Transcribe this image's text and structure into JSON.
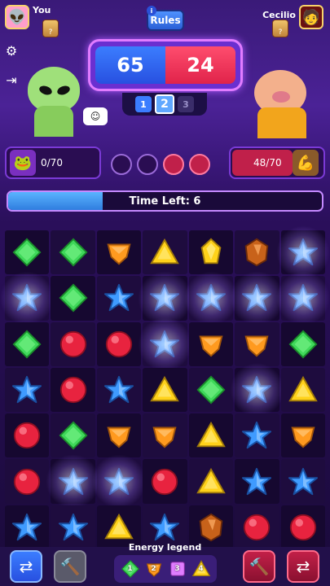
{
  "players": {
    "you": {
      "name": "You",
      "avatar": "alien-avatar-icon",
      "rank": "?"
    },
    "opponent": {
      "name": "Cecilio",
      "avatar": "person-avatar-icon",
      "rank": "?"
    }
  },
  "rules_label": "Rules",
  "score": {
    "you": "65",
    "opponent": "24"
  },
  "rounds": [
    "1",
    "2",
    "3"
  ],
  "active_round": 2,
  "energy": {
    "you": "0/70",
    "opponent": "48/70",
    "opponent_fill": 0.686
  },
  "time_left": {
    "label": "Time Left: 6",
    "fraction": 0.3
  },
  "board": [
    [
      "green",
      "green",
      "orange",
      "yellow",
      "yellow-crystal",
      "orange-crystal",
      "star"
    ],
    [
      "star",
      "green",
      "star",
      "star",
      "star",
      "star",
      "star"
    ],
    [
      "green",
      "red",
      "red",
      "star",
      "orange",
      "orange",
      "green"
    ],
    [
      "star",
      "red",
      "star",
      "yellow",
      "green",
      "star",
      "yellow"
    ],
    [
      "red",
      "green",
      "orange",
      "orange",
      "yellow",
      "star",
      "orange"
    ],
    [
      "red",
      "star",
      "star",
      "red",
      "yellow",
      "star",
      "star"
    ],
    [
      "star",
      "star",
      "yellow",
      "star",
      "orange-crystal",
      "red",
      "red"
    ]
  ],
  "glowing": [
    [
      0,
      6
    ],
    [
      1,
      0
    ],
    [
      1,
      3
    ],
    [
      1,
      4
    ],
    [
      1,
      5
    ],
    [
      1,
      6
    ],
    [
      2,
      3
    ],
    [
      3,
      5
    ],
    [
      5,
      1
    ],
    [
      5,
      2
    ]
  ],
  "legend": {
    "title": "Energy legend",
    "items": [
      {
        "color": "green",
        "value": "1"
      },
      {
        "color": "orange",
        "value": "2"
      },
      {
        "color": "pink",
        "value": "3"
      },
      {
        "color": "yellow",
        "value": "4"
      }
    ]
  },
  "colors": {
    "green": "#3fd85a",
    "red": "#e8233f",
    "orange": "#ff9a1f",
    "yellow": "#ffd21a",
    "star": "#3f9bff",
    "pink": "#e07cff",
    "blue-score": "#2850e0",
    "red-score": "#e0234a"
  }
}
